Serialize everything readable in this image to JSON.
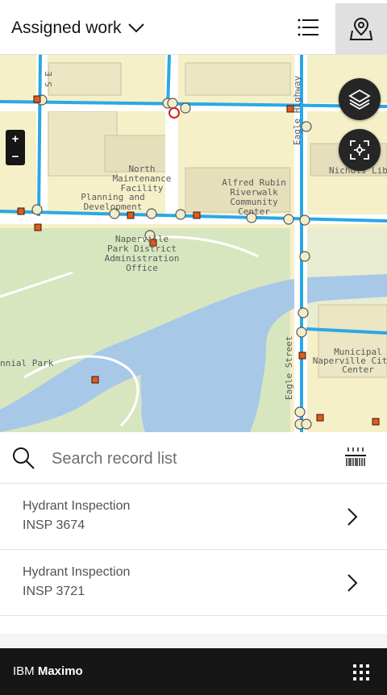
{
  "header": {
    "title": "Assigned work",
    "list_icon": "list-icon",
    "map_icon": "map-pin-icon"
  },
  "map": {
    "labels": {
      "north_maintenance": [
        "North",
        "Maintenance",
        "Facility"
      ],
      "planning": [
        "Planning and",
        "Development"
      ],
      "alfred_rubin": [
        "Alfred Rubin",
        "Riverwalk",
        "Community",
        "Center"
      ],
      "park_district": [
        "Naperville",
        "Park District",
        "Administration",
        "Office"
      ],
      "nichols": "Nichols Libr",
      "municipal": [
        "Municipal",
        "Naperville City H",
        "Center"
      ],
      "park": "nnial Park",
      "street_s": "S E",
      "eagle_top": "Eagle Highway",
      "eagle_bottom": "Eagle Street"
    },
    "zoom_in": "+",
    "zoom_out": "−",
    "layers_icon": "layers-icon",
    "locate_icon": "locate-icon"
  },
  "search": {
    "placeholder": "Search record list",
    "icon": "search-icon",
    "barcode_icon": "barcode-icon"
  },
  "records": [
    {
      "type": "Hydrant Inspection",
      "id": "INSP 3674"
    },
    {
      "type": "Hydrant Inspection",
      "id": "INSP 3721"
    }
  ],
  "footer": {
    "brand_prefix": "IBM",
    "brand_name": "Maximo",
    "apps_icon": "app-switcher-icon"
  }
}
